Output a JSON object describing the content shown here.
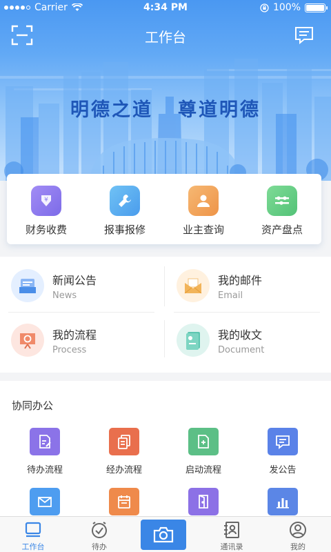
{
  "status_bar": {
    "carrier": "Carrier",
    "time": "4:34 PM",
    "battery": "100%"
  },
  "header": {
    "title": "工作台"
  },
  "banner": {
    "slogan_left": "明德之道",
    "slogan_right": "尊道明德"
  },
  "quick_actions": [
    {
      "label": "财务收费",
      "icon": "finance-icon",
      "color": "#8d7ef0"
    },
    {
      "label": "报事报修",
      "icon": "wrench-icon",
      "color": "#5aaef0"
    },
    {
      "label": "业主查询",
      "icon": "user-icon",
      "color": "#f2a55a"
    },
    {
      "label": "资产盘点",
      "icon": "asset-icon",
      "color": "#67cf8a"
    }
  ],
  "office": [
    {
      "title": "新闻公告",
      "subtitle": "News",
      "icon": "news-icon"
    },
    {
      "title": "我的邮件",
      "subtitle": "Email",
      "icon": "mail-icon"
    },
    {
      "title": "我的流程",
      "subtitle": "Process",
      "icon": "process-icon"
    },
    {
      "title": "我的收文",
      "subtitle": "Document",
      "icon": "document-icon"
    }
  ],
  "collab": {
    "title": "协同办公",
    "items": [
      {
        "label": "待办流程",
        "icon": "todo-flow-icon",
        "color": "#8b73e8"
      },
      {
        "label": "经办流程",
        "icon": "handled-flow-icon",
        "color": "#e96f4d"
      },
      {
        "label": "启动流程",
        "icon": "start-flow-icon",
        "color": "#5cbf86"
      },
      {
        "label": "发公告",
        "icon": "announce-icon",
        "color": "#5a82e8"
      },
      {
        "label": "",
        "icon": "envelope-icon",
        "color": "#4e9df0"
      },
      {
        "label": "",
        "icon": "calendar-icon",
        "color": "#ef8a4b"
      },
      {
        "label": "",
        "icon": "door-icon",
        "color": "#8c71e6"
      },
      {
        "label": "",
        "icon": "report-icon",
        "color": "#5b86e6"
      }
    ]
  },
  "tabbar": [
    {
      "label": "工作台",
      "icon": "workbench-icon",
      "active": true
    },
    {
      "label": "待办",
      "icon": "clock-icon",
      "active": false
    },
    {
      "label": "",
      "icon": "camera-icon",
      "active": false
    },
    {
      "label": "通讯录",
      "icon": "contacts-icon",
      "active": false
    },
    {
      "label": "我的",
      "icon": "profile-icon",
      "active": false
    }
  ]
}
